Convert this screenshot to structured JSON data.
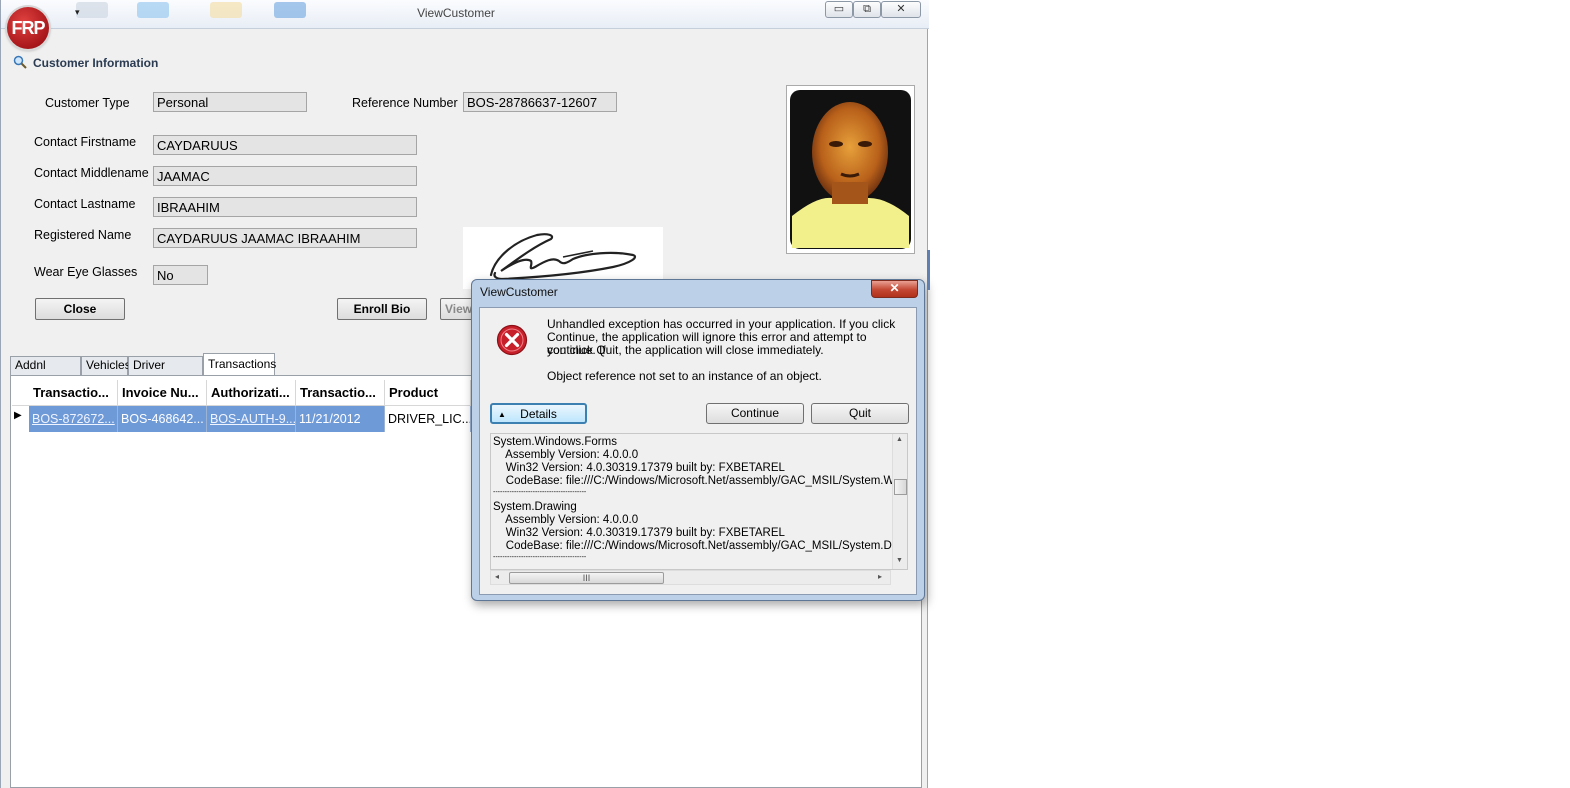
{
  "window": {
    "title": "ViewCustomer",
    "logo_text": "FRP",
    "controls": {
      "minimize": "▭",
      "restore": "⧉",
      "close": "✕"
    }
  },
  "section": {
    "title": "Customer Information"
  },
  "form": {
    "customer_type_label": "Customer Type",
    "customer_type_value": "Personal",
    "reference_number_label": "Reference Number",
    "reference_number_value": "BOS-28786637-12607",
    "firstname_label": "Contact Firstname",
    "firstname_value": "CAYDARUUS",
    "middlename_label": "Contact Middlename",
    "middlename_value": "JAAMAC",
    "lastname_label": "Contact Lastname",
    "lastname_value": "IBRAAHIM",
    "registered_name_label": "Registered Name",
    "registered_name_value": "CAYDARUUS JAAMAC IBRAAHIM",
    "eye_glasses_label": "Wear Eye Glasses",
    "eye_glasses_value": "No"
  },
  "buttons": {
    "close": "Close",
    "enroll_bio": "Enroll Bio",
    "view": "View"
  },
  "tabs": [
    "Addnl Details",
    "Vehicles",
    "Driver License",
    "Transactions"
  ],
  "grid": {
    "headers": [
      "Transactio...",
      "Invoice Nu...",
      "Authorizati...",
      "Transactio...",
      "Product"
    ],
    "rows": [
      [
        "BOS-872672...",
        "BOS-468642...",
        "BOS-AUTH-9...",
        "11/21/2012",
        "DRIVER_LIC..."
      ]
    ]
  },
  "dialog": {
    "title": "ViewCustomer",
    "close": "✕",
    "message_lines": [
      "Unhandled exception has occurred in your application. If you click",
      "Continue, the application will ignore this error and attempt to continue. If",
      "you click Quit, the application will close immediately."
    ],
    "detail_message": "Object reference not set to an instance of an object.",
    "details_button": "Details",
    "continue_button": "Continue",
    "quit_button": "Quit",
    "log_lines": [
      "System.Windows.Forms",
      "    Assembly Version: 4.0.0.0",
      "    Win32 Version: 4.0.30319.17379 built by: FXBETAREL",
      "    CodeBase: file:///C:/Windows/Microsoft.Net/assembly/GAC_MSIL/System.Windows.Forms",
      "----------------------------------------",
      "System.Drawing",
      "    Assembly Version: 4.0.0.0",
      "    Win32 Version: 4.0.30319.17379 built by: FXBETAREL",
      "    CodeBase: file:///C:/Windows/Microsoft.Net/assembly/GAC_MSIL/System.Drawing",
      "----------------------------------------"
    ],
    "scroll_thumb_glyph": "III"
  },
  "colors": {
    "selection": "#6f9ad8",
    "dialog_frame": "#bcd0e8",
    "error_red": "#c8202b"
  }
}
